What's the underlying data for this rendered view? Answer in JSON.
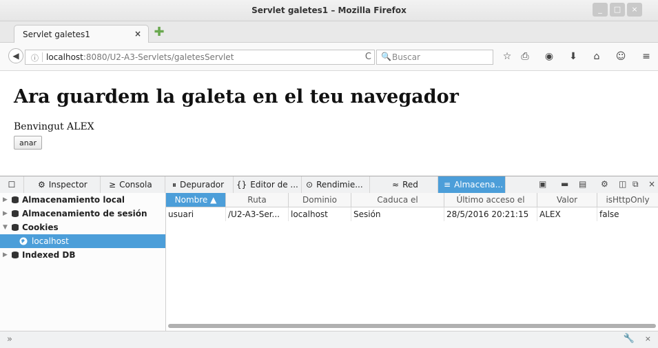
{
  "window": {
    "title": "Servlet galetes1 – Mozilla Firefox",
    "minimize": "_",
    "maximize": "□",
    "close": "×"
  },
  "tab": {
    "label": "Servlet galetes1",
    "close": "×",
    "new_tab": "✚"
  },
  "navbar": {
    "back": "◀",
    "info": "ⓘ",
    "url_host": "localhost",
    "url_rest": ":8080/U2-A3-Servlets/galetesServlet",
    "reload": "C",
    "search_icon": "🔍",
    "search_placeholder": "Buscar",
    "icons": [
      "☆",
      "⎙",
      "◉",
      "⬇",
      "⌂",
      "☺",
      "≡"
    ]
  },
  "page": {
    "heading": "Ara guardem la galeta en el teu navegador",
    "welcome": "Benvingut ALEX",
    "button": "anar"
  },
  "devtools": {
    "tabs": [
      {
        "icon": "☐",
        "label": ""
      },
      {
        "icon": "⚙",
        "label": "Inspector"
      },
      {
        "icon": "≥",
        "label": "Consola"
      },
      {
        "icon": "⏸",
        "label": "Depurador"
      },
      {
        "icon": "{}",
        "label": "Editor de ..."
      },
      {
        "icon": "⊙",
        "label": "Rendimie..."
      },
      {
        "icon": "≈",
        "label": "Red"
      },
      {
        "icon": "≡",
        "label": "Almacena..."
      }
    ],
    "tools": [
      "▣",
      "▬",
      "▤",
      "⚙",
      "◫",
      "⧉",
      "×"
    ],
    "sidebar": [
      {
        "label": "Almacenamiento local",
        "arrow": "▶"
      },
      {
        "label": "Almacenamiento de sesión",
        "arrow": "▶"
      },
      {
        "label": "Cookies",
        "arrow": "▼"
      },
      {
        "label": "localhost",
        "arrow": ""
      },
      {
        "label": "Indexed DB",
        "arrow": "▶"
      }
    ],
    "columns": [
      "Nombre ▲",
      "Ruta",
      "Dominio",
      "Caduca el",
      "Último acceso el",
      "Valor",
      "isHttpOnly"
    ],
    "rows": [
      [
        "usuari",
        "/U2-A3-Ser...",
        "localhost",
        "Sesión",
        "28/5/2016 20:21:15",
        "ALEX",
        "false"
      ]
    ]
  },
  "statusbar": {
    "chevron": "»",
    "wrench": "🔧",
    "close": "×"
  },
  "colors": {
    "accent": "#4c9ed9"
  }
}
